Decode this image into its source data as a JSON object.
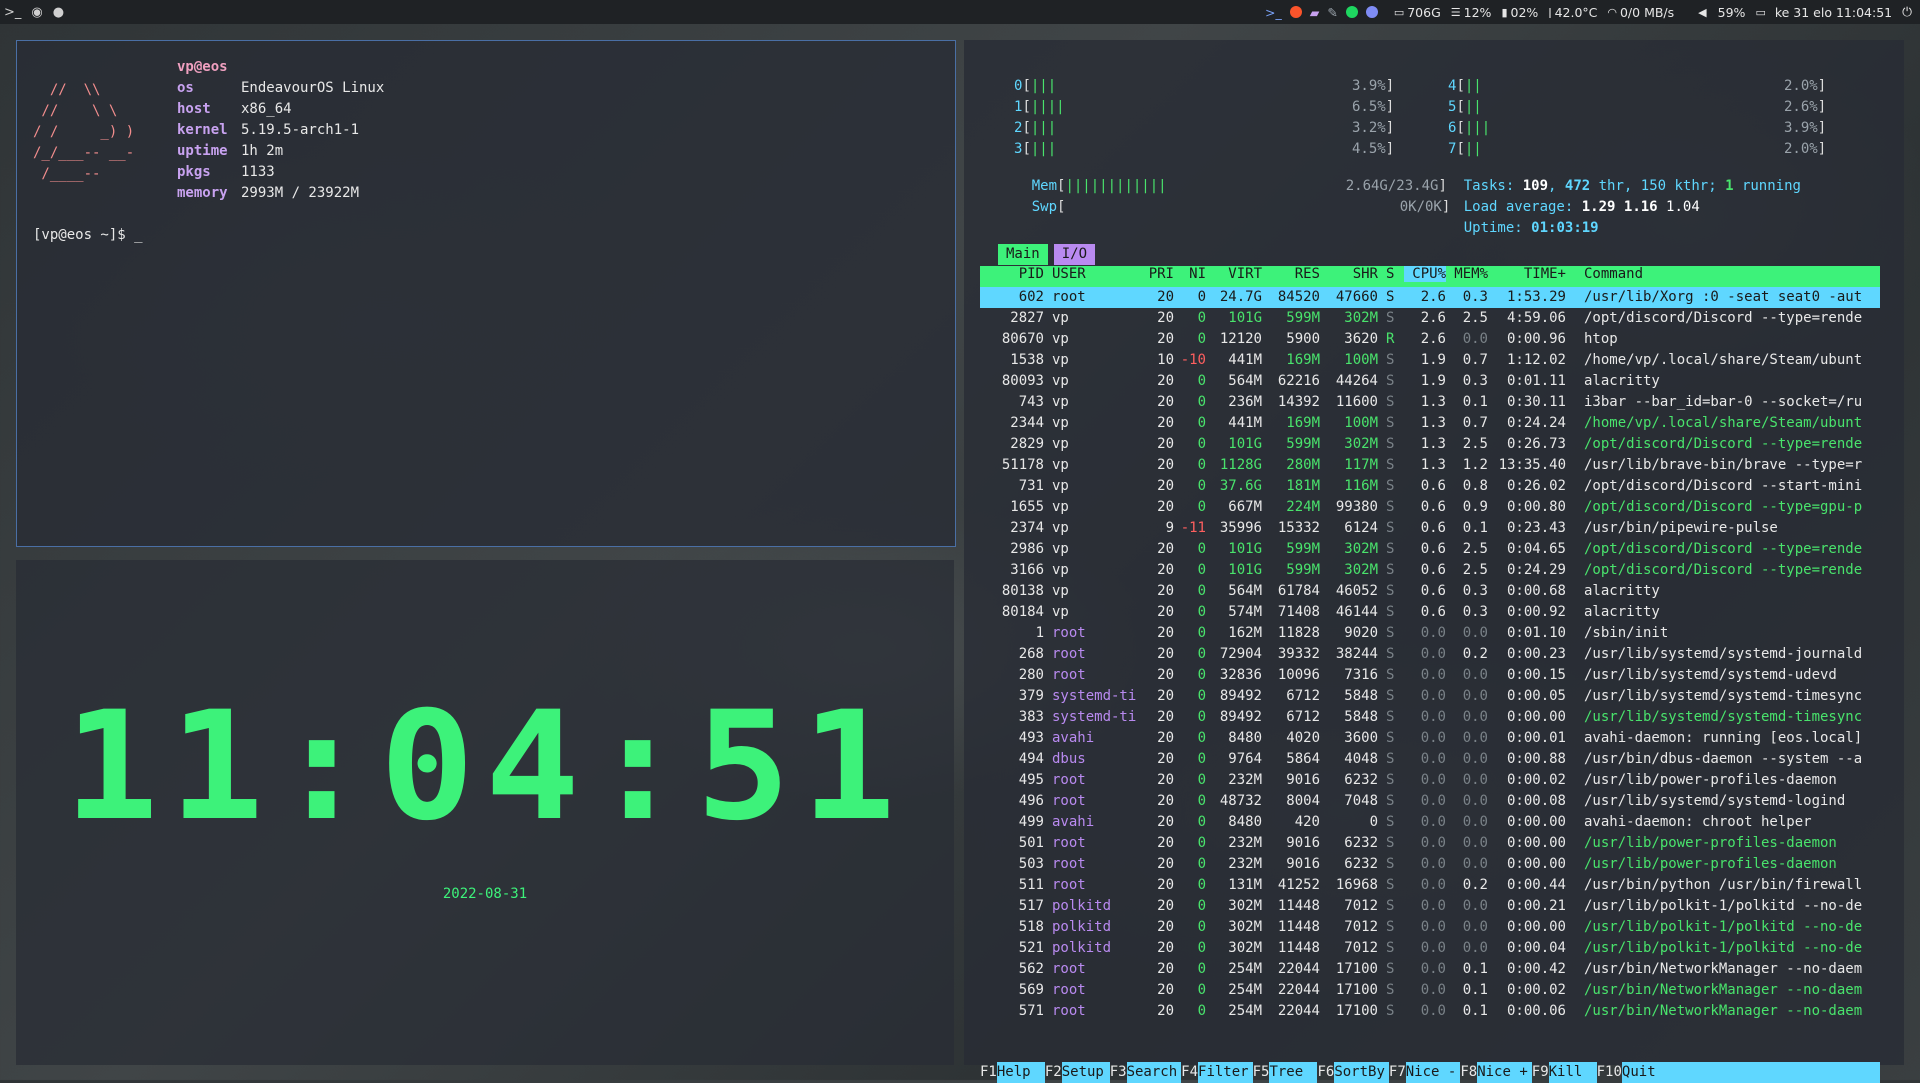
{
  "topbar": {
    "left_icons": [
      "terminal-icon",
      "browser-icon",
      "chat-icon"
    ],
    "disk": "706G",
    "ram": "12%",
    "cpu": "02%",
    "temp": "42.0°C",
    "net": "0/0 MB/s",
    "volume": "59%",
    "datetime": "ke 31 elo 11:04:51"
  },
  "neofetch": {
    "user": "vp@eos",
    "logo_lines": [
      "",
      "  //  \\\\",
      " //    \\ \\",
      "/ /     _) )",
      "/_/___-- __-",
      " /____--"
    ],
    "rows": [
      {
        "key": "os",
        "val": "EndeavourOS Linux"
      },
      {
        "key": "host",
        "val": "x86_64"
      },
      {
        "key": "kernel",
        "val": "5.19.5-arch1-1"
      },
      {
        "key": "uptime",
        "val": "1h 2m"
      },
      {
        "key": "pkgs",
        "val": "1133"
      },
      {
        "key": "memory",
        "val": "2993M / 23922M"
      }
    ],
    "prompt": "[vp@eos ~]$ _"
  },
  "clock": {
    "time": "11:04:51",
    "date": "2022-08-31"
  },
  "htop": {
    "cpus": [
      {
        "id": "0",
        "bars": "|||",
        "pct": "3.9%"
      },
      {
        "id": "1",
        "bars": "||||",
        "pct": "6.5%"
      },
      {
        "id": "2",
        "bars": "|||",
        "pct": "3.2%"
      },
      {
        "id": "3",
        "bars": "|||",
        "pct": "4.5%"
      },
      {
        "id": "4",
        "bars": "||",
        "pct": "2.0%"
      },
      {
        "id": "5",
        "bars": "||",
        "pct": "2.6%"
      },
      {
        "id": "6",
        "bars": "|||",
        "pct": "3.9%"
      },
      {
        "id": "7",
        "bars": "||",
        "pct": "2.0%"
      }
    ],
    "mem": {
      "label": "Mem",
      "bars": "||||||||||||",
      "value": "2.64G/23.4G"
    },
    "swp": {
      "label": "Swp",
      "value": "0K/0K"
    },
    "tasks": {
      "label": "Tasks:",
      "tasks": "109",
      "thr": "472",
      "thr_label": "thr,",
      "kthr": "150 kthr;",
      "running": "1",
      "running_label": "running"
    },
    "load": {
      "label": "Load average:",
      "v1": "1.29",
      "v5": "1.16",
      "v15": "1.04"
    },
    "uptime": {
      "label": "Uptime:",
      "value": "01:03:19"
    },
    "tabs": [
      "Main",
      "I/O"
    ],
    "headers": {
      "pid": "PID",
      "user": "USER",
      "pri": "PRI",
      "ni": "NI",
      "virt": "VIRT",
      "res": "RES",
      "shr": "SHR",
      "s": "S",
      "cpu": "CPU%",
      "mem": "MEM%",
      "time": "TIME+",
      "cmd": "Command"
    },
    "processes": [
      {
        "pid": "602",
        "user": "root",
        "pri": "20",
        "ni": "0",
        "virt": "24.7G",
        "res": "84520",
        "shr": "47660",
        "s": "S",
        "cpu": "2.6",
        "mem": "0.3",
        "time": "1:53.29",
        "cmd": "/usr/lib/Xorg :0 -seat seat0 -aut"
      },
      {
        "pid": "2827",
        "user": "vp",
        "pri": "20",
        "ni": "0",
        "virt": "101G",
        "res": "599M",
        "shr": "302M",
        "s": "S",
        "cpu": "2.6",
        "mem": "2.5",
        "time": "4:59.06",
        "cmd": "/opt/discord/Discord --type=rende"
      },
      {
        "pid": "80670",
        "user": "vp",
        "pri": "20",
        "ni": "0",
        "virt": "12120",
        "res": "5900",
        "shr": "3620",
        "s": "R",
        "cpu": "2.6",
        "mem": "0.0",
        "time": "0:00.96",
        "cmd": "htop"
      },
      {
        "pid": "1538",
        "user": "vp",
        "pri": "10",
        "ni": "-10",
        "virt": "441M",
        "res": "169M",
        "shr": "100M",
        "s": "S",
        "cpu": "1.9",
        "mem": "0.7",
        "time": "1:12.02",
        "cmd": "/home/vp/.local/share/Steam/ubunt"
      },
      {
        "pid": "80093",
        "user": "vp",
        "pri": "20",
        "ni": "0",
        "virt": "564M",
        "res": "62216",
        "shr": "44264",
        "s": "S",
        "cpu": "1.9",
        "mem": "0.3",
        "time": "0:01.11",
        "cmd": "alacritty"
      },
      {
        "pid": "743",
        "user": "vp",
        "pri": "20",
        "ni": "0",
        "virt": "236M",
        "res": "14392",
        "shr": "11600",
        "s": "S",
        "cpu": "1.3",
        "mem": "0.1",
        "time": "0:30.11",
        "cmd": "i3bar --bar_id=bar-0 --socket=/ru"
      },
      {
        "pid": "2344",
        "user": "vp",
        "pri": "20",
        "ni": "0",
        "virt": "441M",
        "res": "169M",
        "shr": "100M",
        "s": "S",
        "cpu": "1.3",
        "mem": "0.7",
        "time": "0:24.24",
        "cmd": "/home/vp/.local/share/Steam/ubunt"
      },
      {
        "pid": "2829",
        "user": "vp",
        "pri": "20",
        "ni": "0",
        "virt": "101G",
        "res": "599M",
        "shr": "302M",
        "s": "S",
        "cpu": "1.3",
        "mem": "2.5",
        "time": "0:26.73",
        "cmd": "/opt/discord/Discord --type=rende"
      },
      {
        "pid": "51178",
        "user": "vp",
        "pri": "20",
        "ni": "0",
        "virt": "1128G",
        "res": "280M",
        "shr": "117M",
        "s": "S",
        "cpu": "1.3",
        "mem": "1.2",
        "time": "13:35.40",
        "cmd": "/usr/lib/brave-bin/brave --type=r"
      },
      {
        "pid": "731",
        "user": "vp",
        "pri": "20",
        "ni": "0",
        "virt": "37.6G",
        "res": "181M",
        "shr": "116M",
        "s": "S",
        "cpu": "0.6",
        "mem": "0.8",
        "time": "0:26.02",
        "cmd": "/opt/discord/Discord --start-mini"
      },
      {
        "pid": "1655",
        "user": "vp",
        "pri": "20",
        "ni": "0",
        "virt": "667M",
        "res": "224M",
        "shr": "99380",
        "s": "S",
        "cpu": "0.6",
        "mem": "0.9",
        "time": "0:00.80",
        "cmd": "/opt/discord/Discord --type=gpu-p"
      },
      {
        "pid": "2374",
        "user": "vp",
        "pri": "9",
        "ni": "-11",
        "virt": "35996",
        "res": "15332",
        "shr": "6124",
        "s": "S",
        "cpu": "0.6",
        "mem": "0.1",
        "time": "0:23.43",
        "cmd": "/usr/bin/pipewire-pulse"
      },
      {
        "pid": "2986",
        "user": "vp",
        "pri": "20",
        "ni": "0",
        "virt": "101G",
        "res": "599M",
        "shr": "302M",
        "s": "S",
        "cpu": "0.6",
        "mem": "2.5",
        "time": "0:04.65",
        "cmd": "/opt/discord/Discord --type=rende"
      },
      {
        "pid": "3166",
        "user": "vp",
        "pri": "20",
        "ni": "0",
        "virt": "101G",
        "res": "599M",
        "shr": "302M",
        "s": "S",
        "cpu": "0.6",
        "mem": "2.5",
        "time": "0:24.29",
        "cmd": "/opt/discord/Discord --type=rende"
      },
      {
        "pid": "80138",
        "user": "vp",
        "pri": "20",
        "ni": "0",
        "virt": "564M",
        "res": "61784",
        "shr": "46052",
        "s": "S",
        "cpu": "0.6",
        "mem": "0.3",
        "time": "0:00.68",
        "cmd": "alacritty"
      },
      {
        "pid": "80184",
        "user": "vp",
        "pri": "20",
        "ni": "0",
        "virt": "574M",
        "res": "71408",
        "shr": "46144",
        "s": "S",
        "cpu": "0.6",
        "mem": "0.3",
        "time": "0:00.92",
        "cmd": "alacritty"
      },
      {
        "pid": "1",
        "user": "root",
        "pri": "20",
        "ni": "0",
        "virt": "162M",
        "res": "11828",
        "shr": "9020",
        "s": "S",
        "cpu": "0.0",
        "mem": "0.0",
        "time": "0:01.10",
        "cmd": "/sbin/init"
      },
      {
        "pid": "268",
        "user": "root",
        "pri": "20",
        "ni": "0",
        "virt": "72904",
        "res": "39332",
        "shr": "38244",
        "s": "S",
        "cpu": "0.0",
        "mem": "0.2",
        "time": "0:00.23",
        "cmd": "/usr/lib/systemd/systemd-journald"
      },
      {
        "pid": "280",
        "user": "root",
        "pri": "20",
        "ni": "0",
        "virt": "32836",
        "res": "10096",
        "shr": "7316",
        "s": "S",
        "cpu": "0.0",
        "mem": "0.0",
        "time": "0:00.15",
        "cmd": "/usr/lib/systemd/systemd-udevd"
      },
      {
        "pid": "379",
        "user": "systemd-ti",
        "pri": "20",
        "ni": "0",
        "virt": "89492",
        "res": "6712",
        "shr": "5848",
        "s": "S",
        "cpu": "0.0",
        "mem": "0.0",
        "time": "0:00.05",
        "cmd": "/usr/lib/systemd/systemd-timesync"
      },
      {
        "pid": "383",
        "user": "systemd-ti",
        "pri": "20",
        "ni": "0",
        "virt": "89492",
        "res": "6712",
        "shr": "5848",
        "s": "S",
        "cpu": "0.0",
        "mem": "0.0",
        "time": "0:00.00",
        "cmd": "/usr/lib/systemd/systemd-timesync"
      },
      {
        "pid": "493",
        "user": "avahi",
        "pri": "20",
        "ni": "0",
        "virt": "8480",
        "res": "4020",
        "shr": "3600",
        "s": "S",
        "cpu": "0.0",
        "mem": "0.0",
        "time": "0:00.01",
        "cmd": "avahi-daemon: running [eos.local]"
      },
      {
        "pid": "494",
        "user": "dbus",
        "pri": "20",
        "ni": "0",
        "virt": "9764",
        "res": "5864",
        "shr": "4048",
        "s": "S",
        "cpu": "0.0",
        "mem": "0.0",
        "time": "0:00.88",
        "cmd": "/usr/bin/dbus-daemon --system --a"
      },
      {
        "pid": "495",
        "user": "root",
        "pri": "20",
        "ni": "0",
        "virt": "232M",
        "res": "9016",
        "shr": "6232",
        "s": "S",
        "cpu": "0.0",
        "mem": "0.0",
        "time": "0:00.02",
        "cmd": "/usr/lib/power-profiles-daemon"
      },
      {
        "pid": "496",
        "user": "root",
        "pri": "20",
        "ni": "0",
        "virt": "48732",
        "res": "8004",
        "shr": "7048",
        "s": "S",
        "cpu": "0.0",
        "mem": "0.0",
        "time": "0:00.08",
        "cmd": "/usr/lib/systemd/systemd-logind"
      },
      {
        "pid": "499",
        "user": "avahi",
        "pri": "20",
        "ni": "0",
        "virt": "8480",
        "res": "420",
        "shr": "0",
        "s": "S",
        "cpu": "0.0",
        "mem": "0.0",
        "time": "0:00.00",
        "cmd": "avahi-daemon: chroot helper"
      },
      {
        "pid": "501",
        "user": "root",
        "pri": "20",
        "ni": "0",
        "virt": "232M",
        "res": "9016",
        "shr": "6232",
        "s": "S",
        "cpu": "0.0",
        "mem": "0.0",
        "time": "0:00.00",
        "cmd": "/usr/lib/power-profiles-daemon"
      },
      {
        "pid": "503",
        "user": "root",
        "pri": "20",
        "ni": "0",
        "virt": "232M",
        "res": "9016",
        "shr": "6232",
        "s": "S",
        "cpu": "0.0",
        "mem": "0.0",
        "time": "0:00.00",
        "cmd": "/usr/lib/power-profiles-daemon"
      },
      {
        "pid": "511",
        "user": "root",
        "pri": "20",
        "ni": "0",
        "virt": "131M",
        "res": "41252",
        "shr": "16968",
        "s": "S",
        "cpu": "0.0",
        "mem": "0.2",
        "time": "0:00.44",
        "cmd": "/usr/bin/python /usr/bin/firewall"
      },
      {
        "pid": "517",
        "user": "polkitd",
        "pri": "20",
        "ni": "0",
        "virt": "302M",
        "res": "11448",
        "shr": "7012",
        "s": "S",
        "cpu": "0.0",
        "mem": "0.0",
        "time": "0:00.21",
        "cmd": "/usr/lib/polkit-1/polkitd --no-de"
      },
      {
        "pid": "518",
        "user": "polkitd",
        "pri": "20",
        "ni": "0",
        "virt": "302M",
        "res": "11448",
        "shr": "7012",
        "s": "S",
        "cpu": "0.0",
        "mem": "0.0",
        "time": "0:00.00",
        "cmd": "/usr/lib/polkit-1/polkitd --no-de"
      },
      {
        "pid": "521",
        "user": "polkitd",
        "pri": "20",
        "ni": "0",
        "virt": "302M",
        "res": "11448",
        "shr": "7012",
        "s": "S",
        "cpu": "0.0",
        "mem": "0.0",
        "time": "0:00.04",
        "cmd": "/usr/lib/polkit-1/polkitd --no-de"
      },
      {
        "pid": "562",
        "user": "root",
        "pri": "20",
        "ni": "0",
        "virt": "254M",
        "res": "22044",
        "shr": "17100",
        "s": "S",
        "cpu": "0.0",
        "mem": "0.1",
        "time": "0:00.42",
        "cmd": "/usr/bin/NetworkManager --no-daem"
      },
      {
        "pid": "569",
        "user": "root",
        "pri": "20",
        "ni": "0",
        "virt": "254M",
        "res": "22044",
        "shr": "17100",
        "s": "S",
        "cpu": "0.0",
        "mem": "0.1",
        "time": "0:00.02",
        "cmd": "/usr/bin/NetworkManager --no-daem"
      },
      {
        "pid": "571",
        "user": "root",
        "pri": "20",
        "ni": "0",
        "virt": "254M",
        "res": "22044",
        "shr": "17100",
        "s": "S",
        "cpu": "0.0",
        "mem": "0.1",
        "time": "0:00.06",
        "cmd": "/usr/bin/NetworkManager --no-daem"
      }
    ],
    "fkeys": [
      {
        "key": "F1",
        "label": "Help"
      },
      {
        "key": "F2",
        "label": "Setup"
      },
      {
        "key": "F3",
        "label": "Search"
      },
      {
        "key": "F4",
        "label": "Filter"
      },
      {
        "key": "F5",
        "label": "Tree"
      },
      {
        "key": "F6",
        "label": "SortBy"
      },
      {
        "key": "F7",
        "label": "Nice -"
      },
      {
        "key": "F8",
        "label": "Nice +"
      },
      {
        "key": "F9",
        "label": "Kill"
      },
      {
        "key": "F10",
        "label": "Quit"
      }
    ]
  },
  "colors": {
    "accent_green": "#3df27a",
    "accent_cyan": "#5fd7ff",
    "accent_purple": "#b98af0",
    "accent_red": "#ff5f5f"
  }
}
